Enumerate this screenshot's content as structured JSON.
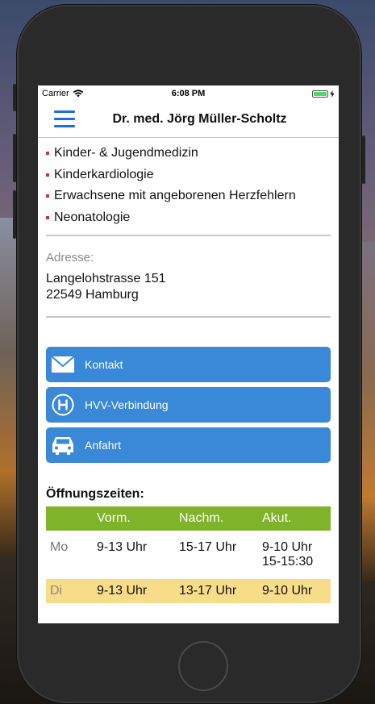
{
  "status_bar": {
    "carrier": "Carrier",
    "time": "6:08 PM"
  },
  "nav": {
    "title": "Dr. med. Jörg Müller-Scholtz"
  },
  "specialties": [
    "Kinder- & Jugendmedizin",
    "Kinderkardiologie",
    "Erwachsene mit angeborenen Herzfehlern",
    "Neonatologie"
  ],
  "address": {
    "label": "Adresse:",
    "street": "Langelohstrasse 151",
    "city": "22549 Hamburg"
  },
  "actions": [
    {
      "label": "Kontakt",
      "icon": "envelope-icon"
    },
    {
      "label": "HVV-Verbindung",
      "icon": "bus-stop-h-icon"
    },
    {
      "label": "Anfahrt",
      "icon": "car-icon"
    }
  ],
  "hours": {
    "title": "Öffnungszeiten:",
    "headers": [
      "",
      "Vorm.",
      "Nachm.",
      "Akut."
    ],
    "rows": [
      {
        "day": "Mo",
        "vorm": "9-13 Uhr",
        "nachm": "15-17 Uhr",
        "akut": [
          "9-10 Uhr",
          "15-15:30"
        ]
      },
      {
        "day": "Di",
        "vorm": "9-13 Uhr",
        "nachm": "13-17 Uhr",
        "akut": [
          "9-10 Uhr"
        ]
      }
    ]
  },
  "colors": {
    "accent_blue": "#3a88d8",
    "menu_blue": "#1a6fe0",
    "header_green": "#7fb32a",
    "today_highlight": "#f7dc8a",
    "bullet_red": "#c0392b"
  }
}
